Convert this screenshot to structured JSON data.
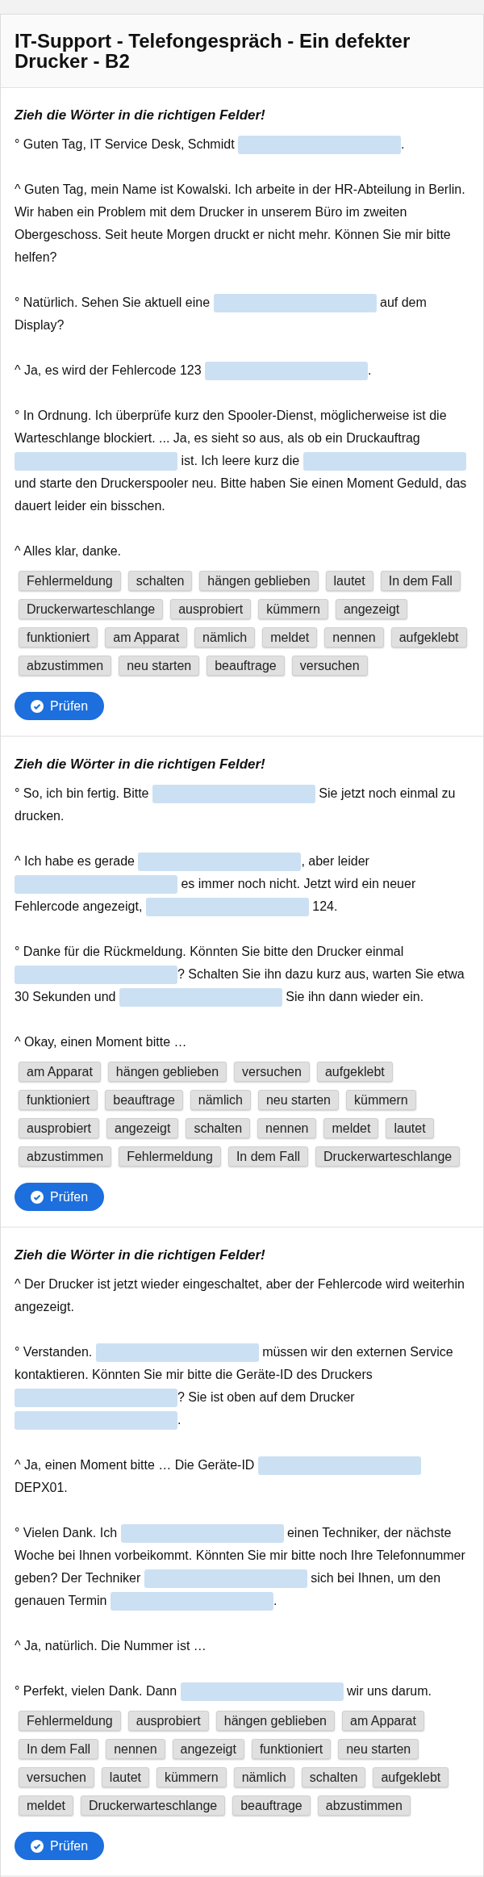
{
  "title": "IT-Support - Telefongespräch - Ein defekter Drucker - B2",
  "sections": [
    {
      "instruction": "Zieh die Wörter in die richtigen Felder!",
      "paragraphs": [
        [
          {
            "kind": "text",
            "text": "° Guten Tag, IT Service Desk, Schmidt "
          },
          {
            "kind": "blank"
          },
          {
            "kind": "text",
            "text": "."
          }
        ],
        [
          {
            "kind": "text",
            "text": "^ Guten Tag, mein Name ist Kowalski. Ich arbeite in der HR-Abteilung in Berlin. Wir haben ein Problem mit dem Drucker in unserem Büro im zweiten Obergeschoss. Seit heute Morgen druckt er nicht mehr. Können Sie mir bitte helfen?"
          }
        ],
        [
          {
            "kind": "text",
            "text": "° Natürlich. Sehen Sie aktuell eine "
          },
          {
            "kind": "blank"
          },
          {
            "kind": "text",
            "text": " auf dem Display?"
          }
        ],
        [
          {
            "kind": "text",
            "text": "^ Ja, es wird der Fehlercode 123 "
          },
          {
            "kind": "blank"
          },
          {
            "kind": "text",
            "text": "."
          }
        ],
        [
          {
            "kind": "text",
            "text": "° In Ordnung. Ich überprüfe kurz den Spooler-Dienst, möglicherweise ist die Warteschlange blockiert. ... Ja, es sieht so aus, als ob ein Druckauftrag "
          },
          {
            "kind": "blank"
          },
          {
            "kind": "text",
            "text": " ist. Ich leere kurz die "
          },
          {
            "kind": "blank"
          },
          {
            "kind": "text",
            "text": " und starte den Druckerspooler neu. Bitte haben Sie einen Moment Geduld, das dauert leider ein bisschen."
          }
        ],
        [
          {
            "kind": "text",
            "text": "^ Alles klar, danke."
          }
        ]
      ],
      "chips": [
        "Fehlermeldung",
        "schalten",
        "hängen geblieben",
        "lautet",
        "In dem Fall",
        "Druckerwarteschlange",
        "ausprobiert",
        "kümmern",
        "angezeigt",
        "funktioniert",
        "am Apparat",
        "nämlich",
        "meldet",
        "nennen",
        "aufgeklebt",
        "abzustimmen",
        "neu starten",
        "beauftrage",
        "versuchen"
      ],
      "button": "Prüfen"
    },
    {
      "instruction": "Zieh die Wörter in die richtigen Felder!",
      "paragraphs": [
        [
          {
            "kind": "text",
            "text": "° So, ich bin fertig. Bitte "
          },
          {
            "kind": "blank"
          },
          {
            "kind": "text",
            "text": " Sie jetzt noch einmal zu drucken."
          }
        ],
        [
          {
            "kind": "text",
            "text": "^ Ich habe es gerade "
          },
          {
            "kind": "blank"
          },
          {
            "kind": "text",
            "text": ", aber leider "
          },
          {
            "kind": "blank"
          },
          {
            "kind": "text",
            "text": " es immer noch nicht. Jetzt wird ein neuer Fehlercode angezeigt, "
          },
          {
            "kind": "blank"
          },
          {
            "kind": "text",
            "text": " 124."
          }
        ],
        [
          {
            "kind": "text",
            "text": "° Danke für die Rückmeldung. Könnten Sie bitte den Drucker einmal "
          },
          {
            "kind": "blank"
          },
          {
            "kind": "text",
            "text": "? Schalten Sie ihn dazu kurz aus, warten Sie etwa 30 Sekunden und "
          },
          {
            "kind": "blank"
          },
          {
            "kind": "text",
            "text": " Sie ihn dann wieder ein."
          }
        ],
        [
          {
            "kind": "text",
            "text": "^ Okay, einen Moment bitte …"
          }
        ]
      ],
      "chips": [
        "am Apparat",
        "hängen geblieben",
        "versuchen",
        "aufgeklebt",
        "funktioniert",
        "beauftrage",
        "nämlich",
        "neu starten",
        "kümmern",
        "ausprobiert",
        "angezeigt",
        "schalten",
        "nennen",
        "meldet",
        "lautet",
        "abzustimmen",
        "Fehlermeldung",
        "In dem Fall",
        "Druckerwarteschlange"
      ],
      "button": "Prüfen"
    },
    {
      "instruction": "Zieh die Wörter in die richtigen Felder!",
      "paragraphs": [
        [
          {
            "kind": "text",
            "text": "^ Der Drucker ist jetzt wieder eingeschaltet, aber der Fehlercode wird weiterhin angezeigt."
          }
        ],
        [
          {
            "kind": "text",
            "text": "° Verstanden. "
          },
          {
            "kind": "blank"
          },
          {
            "kind": "text",
            "text": " müssen wir den externen Service kontaktieren. Könnten Sie mir bitte die Geräte-ID des Druckers "
          },
          {
            "kind": "blank"
          },
          {
            "kind": "text",
            "text": "? Sie ist oben auf dem Drucker "
          },
          {
            "kind": "blank"
          },
          {
            "kind": "text",
            "text": "."
          }
        ],
        [
          {
            "kind": "text",
            "text": "^ Ja, einen Moment bitte … Die Geräte-ID "
          },
          {
            "kind": "blank"
          },
          {
            "kind": "text",
            "text": " DEPX01."
          }
        ],
        [
          {
            "kind": "text",
            "text": "° Vielen Dank. Ich "
          },
          {
            "kind": "blank"
          },
          {
            "kind": "text",
            "text": " einen Techniker, der nächste Woche bei Ihnen vorbeikommt. Könnten Sie mir bitte noch Ihre Telefonnummer geben? Der Techniker "
          },
          {
            "kind": "blank"
          },
          {
            "kind": "text",
            "text": " sich bei Ihnen, um den genauen Termin "
          },
          {
            "kind": "blank"
          },
          {
            "kind": "text",
            "text": "."
          }
        ],
        [
          {
            "kind": "text",
            "text": "^ Ja, natürlich. Die Nummer ist …"
          }
        ],
        [
          {
            "kind": "text",
            "text": "° Perfekt, vielen Dank. Dann "
          },
          {
            "kind": "blank"
          },
          {
            "kind": "text",
            "text": " wir uns darum."
          }
        ]
      ],
      "chips": [
        "Fehlermeldung",
        "ausprobiert",
        "hängen geblieben",
        "am Apparat",
        "In dem Fall",
        "nennen",
        "angezeigt",
        "funktioniert",
        "neu starten",
        "versuchen",
        "lautet",
        "kümmern",
        "nämlich",
        "schalten",
        "aufgeklebt",
        "meldet",
        "Druckerwarteschlange",
        "beauftrage",
        "abzustimmen"
      ],
      "button": "Prüfen"
    }
  ]
}
